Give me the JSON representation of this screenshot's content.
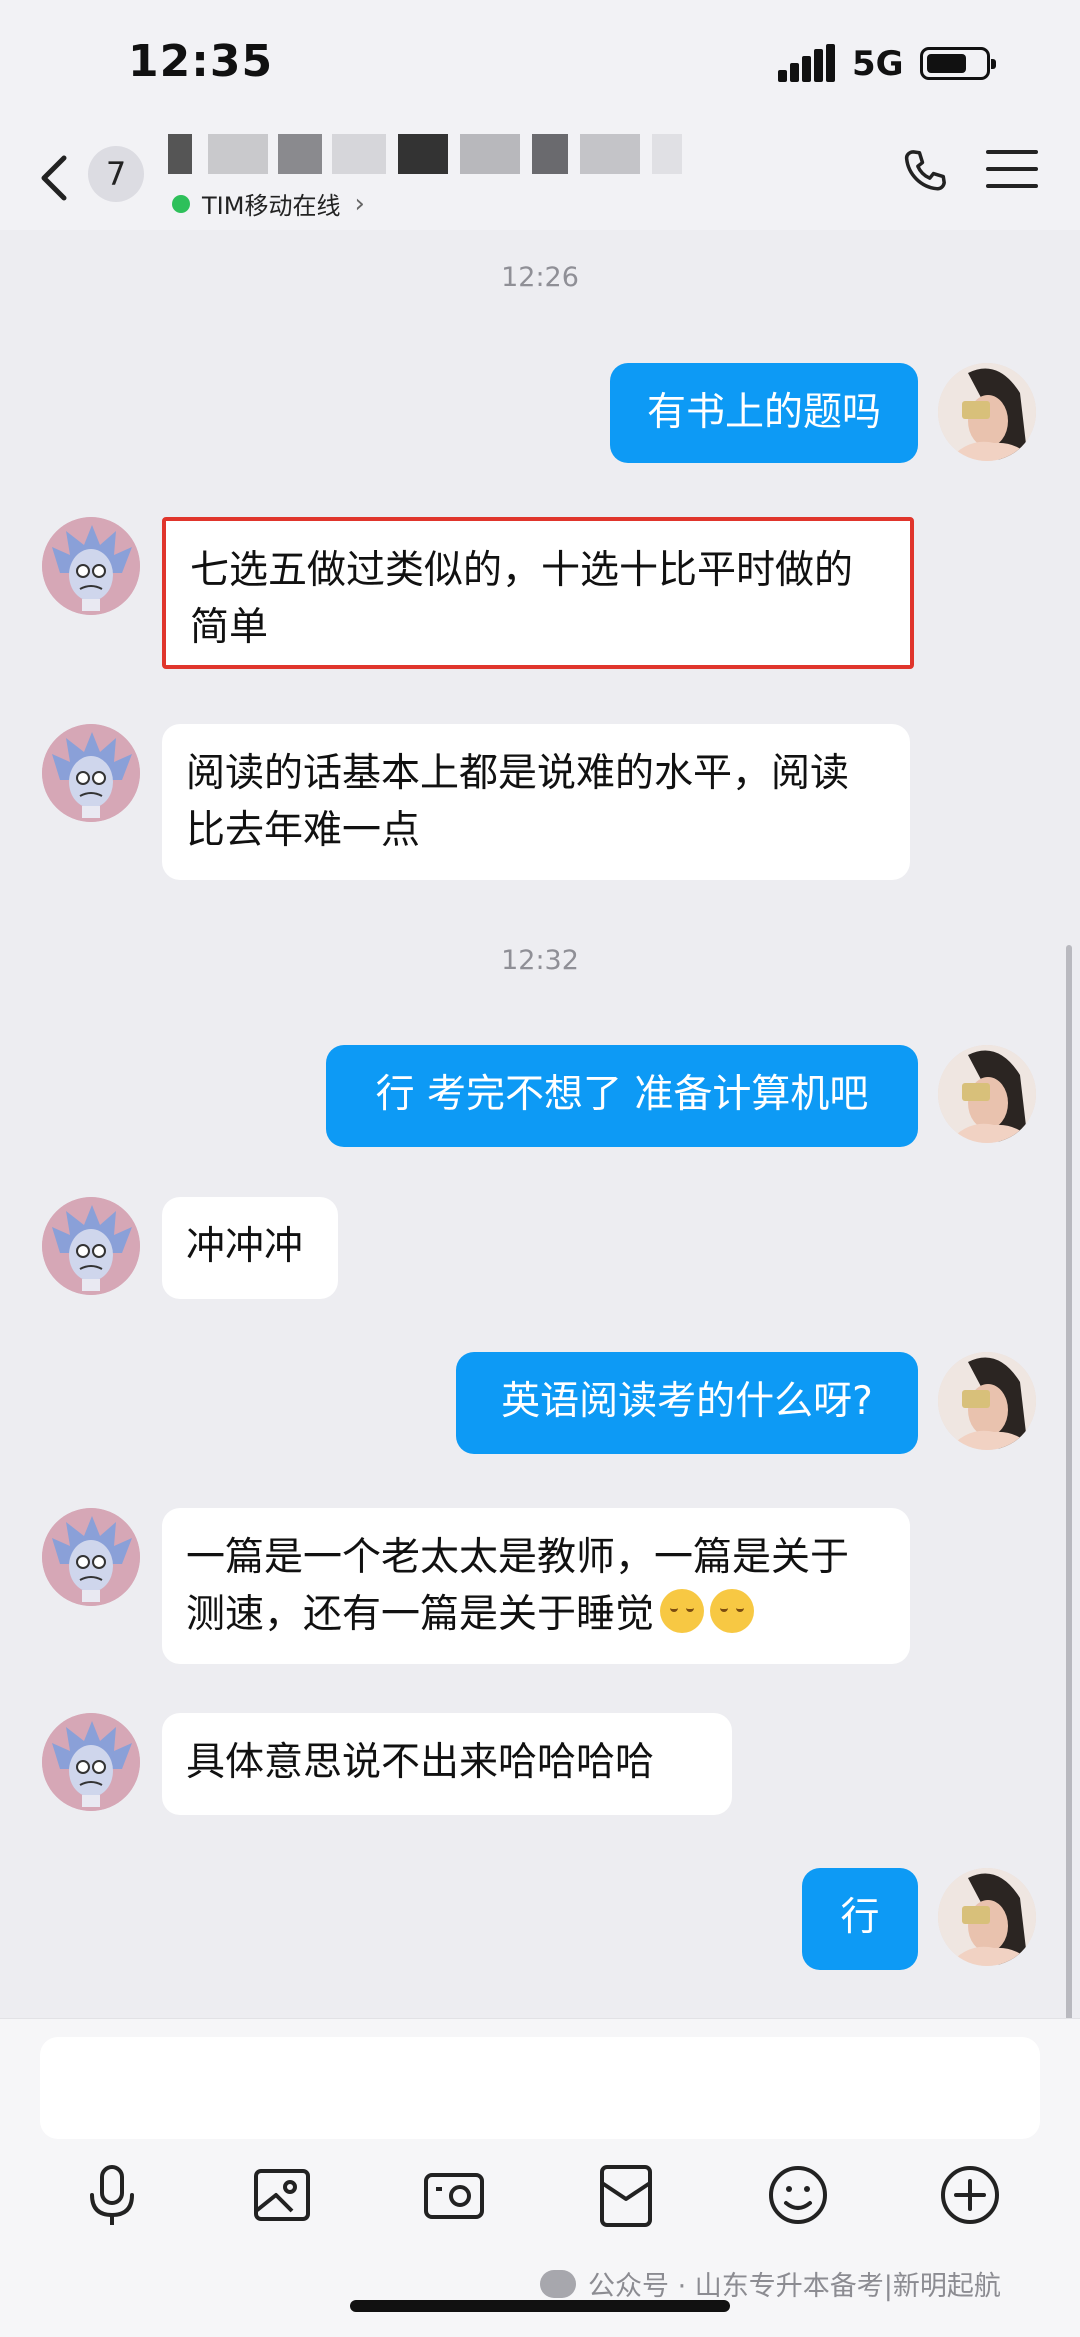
{
  "status_bar": {
    "time": "12:35",
    "network": "5G",
    "battery_level": 0.7
  },
  "header": {
    "unread_count": "7",
    "contact_status": "TIM移动在线"
  },
  "messages": [
    {
      "type": "timestamp",
      "text": "12:26"
    },
    {
      "type": "outgoing",
      "text": "有书上的题吗"
    },
    {
      "type": "incoming",
      "text": "七选五做过类似的，十选十比平时做的简单",
      "highlighted": true
    },
    {
      "type": "incoming",
      "text": "阅读的话基本上都是说难的水平，阅读比去年难一点"
    },
    {
      "type": "timestamp",
      "text": "12:32"
    },
    {
      "type": "outgoing",
      "text": "行 考完不想了 准备计算机吧"
    },
    {
      "type": "incoming",
      "text": "冲冲冲"
    },
    {
      "type": "outgoing",
      "text": "英语阅读考的什么呀?"
    },
    {
      "type": "incoming",
      "text": "一篇是一个老太太是教师，一篇是关于测速，还有一篇是关于睡觉",
      "emoji": "relieved-face-icon"
    },
    {
      "type": "incoming",
      "text": "具体意思说不出来哈哈哈哈"
    },
    {
      "type": "outgoing",
      "text": "行"
    }
  ],
  "toolbar": {
    "icons": [
      "microphone-icon",
      "image-icon",
      "camera-icon",
      "red-envelope-icon",
      "emoji-icon",
      "plus-icon"
    ]
  },
  "watermark": "公众号 · 山东专升本备考|新明起航",
  "colors": {
    "outgoing_bubble": "#0d9af5",
    "incoming_bubble": "#ffffff",
    "background": "#ededf1",
    "online_dot": "#2ec05a",
    "highlight_border": "#e0352c"
  }
}
